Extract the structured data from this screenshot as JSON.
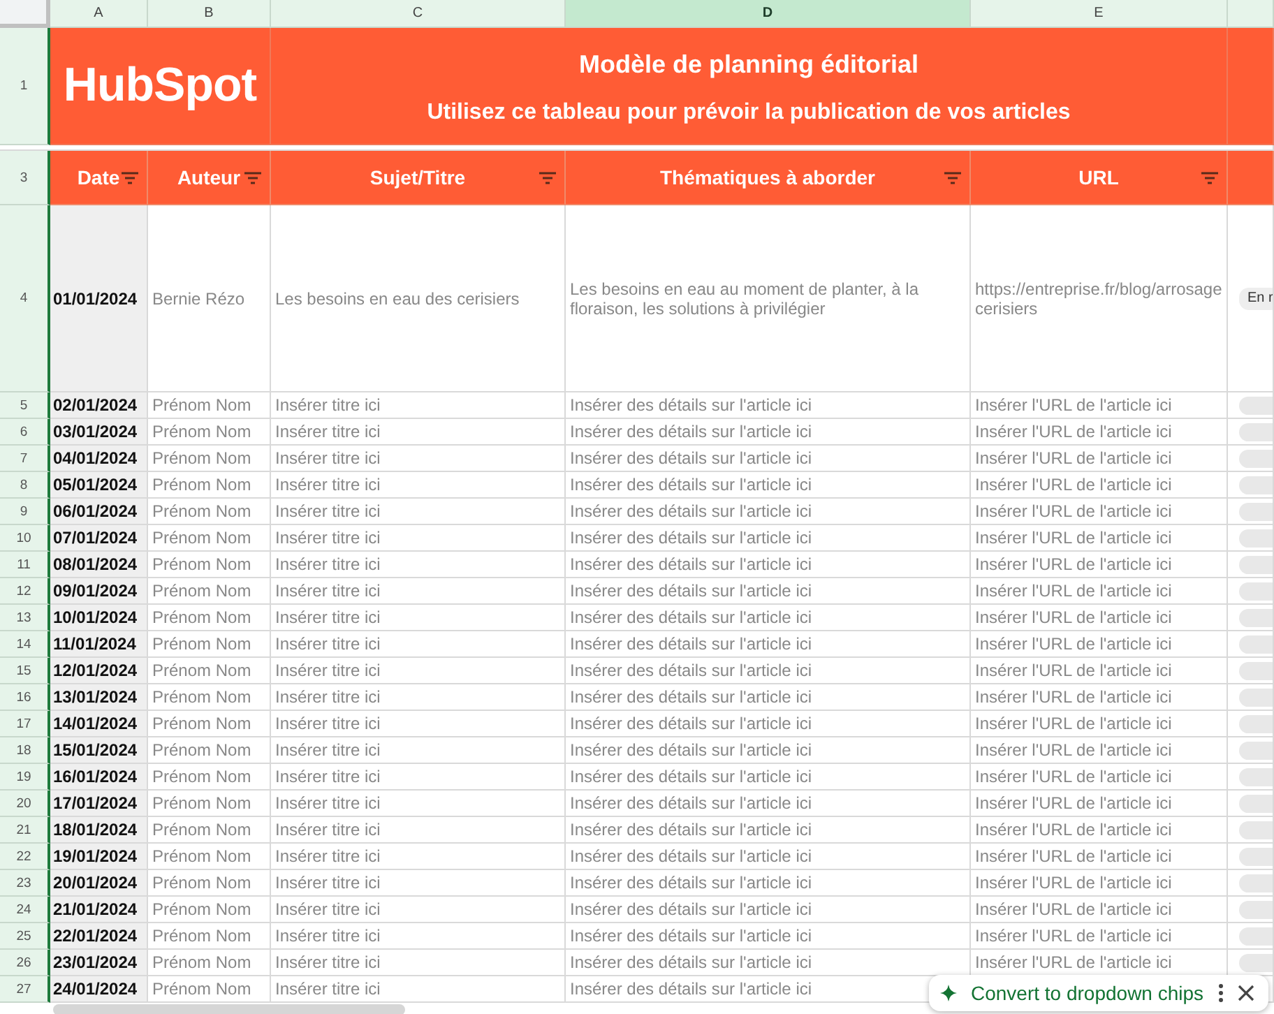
{
  "columns": [
    {
      "label": "A",
      "selected": false
    },
    {
      "label": "B",
      "selected": false
    },
    {
      "label": "C",
      "selected": false
    },
    {
      "label": "D",
      "selected": true
    },
    {
      "label": "E",
      "selected": false
    }
  ],
  "banner": {
    "row": "1",
    "logo": "HubSpot",
    "title": "Modèle de planning éditorial",
    "subtitle": "Utilisez ce tableau pour prévoir la publication de vos articles"
  },
  "header_row": {
    "row": "3",
    "headers": [
      {
        "label": "Date",
        "filter": true
      },
      {
        "label": "Auteur",
        "filter": true
      },
      {
        "label": "Sujet/Titre",
        "filter": true
      },
      {
        "label": "Thématiques à aborder",
        "filter": true
      },
      {
        "label": "URL",
        "filter": true
      }
    ]
  },
  "rows": [
    {
      "row": "4",
      "date": "01/01/2024",
      "author": "Bernie Rézo",
      "title": "Les besoins en eau des cerisiers",
      "topics": "Les besoins en eau au moment de planter, à la floraison, les solutions à privilégier",
      "url": "https://entreprise.fr/blog/arrosage cerisiers",
      "status": "En r"
    },
    {
      "row": "5",
      "date": "02/01/2024",
      "author": "Prénom Nom",
      "title": "Insérer titre ici",
      "topics": "Insérer des détails sur l'article ici",
      "url": "Insérer l'URL de l'article ici",
      "status_chip": true
    },
    {
      "row": "6",
      "date": "03/01/2024",
      "author": "Prénom Nom",
      "title": "Insérer titre ici",
      "topics": "Insérer des détails sur l'article ici",
      "url": "Insérer l'URL de l'article ici",
      "status_chip": true
    },
    {
      "row": "7",
      "date": "04/01/2024",
      "author": "Prénom Nom",
      "title": "Insérer titre ici",
      "topics": "Insérer des détails sur l'article ici",
      "url": "Insérer l'URL de l'article ici",
      "status_chip": true
    },
    {
      "row": "8",
      "date": "05/01/2024",
      "author": "Prénom Nom",
      "title": "Insérer titre ici",
      "topics": "Insérer des détails sur l'article ici",
      "url": "Insérer l'URL de l'article ici",
      "status_chip": true
    },
    {
      "row": "9",
      "date": "06/01/2024",
      "author": "Prénom Nom",
      "title": "Insérer titre ici",
      "topics": "Insérer des détails sur l'article ici",
      "url": "Insérer l'URL de l'article ici",
      "status_chip": true
    },
    {
      "row": "10",
      "date": "07/01/2024",
      "author": "Prénom Nom",
      "title": "Insérer titre ici",
      "topics": "Insérer des détails sur l'article ici",
      "url": "Insérer l'URL de l'article ici",
      "status_chip": true
    },
    {
      "row": "11",
      "date": "08/01/2024",
      "author": "Prénom Nom",
      "title": "Insérer titre ici",
      "topics": "Insérer des détails sur l'article ici",
      "url": "Insérer l'URL de l'article ici",
      "status_chip": true
    },
    {
      "row": "12",
      "date": "09/01/2024",
      "author": "Prénom Nom",
      "title": "Insérer titre ici",
      "topics": "Insérer des détails sur l'article ici",
      "url": "Insérer l'URL de l'article ici",
      "status_chip": true
    },
    {
      "row": "13",
      "date": "10/01/2024",
      "author": "Prénom Nom",
      "title": "Insérer titre ici",
      "topics": "Insérer des détails sur l'article ici",
      "url": "Insérer l'URL de l'article ici",
      "status_chip": true
    },
    {
      "row": "14",
      "date": "11/01/2024",
      "author": "Prénom Nom",
      "title": "Insérer titre ici",
      "topics": "Insérer des détails sur l'article ici",
      "url": "Insérer l'URL de l'article ici",
      "status_chip": true
    },
    {
      "row": "15",
      "date": "12/01/2024",
      "author": "Prénom Nom",
      "title": "Insérer titre ici",
      "topics": "Insérer des détails sur l'article ici",
      "url": "Insérer l'URL de l'article ici",
      "status_chip": true
    },
    {
      "row": "16",
      "date": "13/01/2024",
      "author": "Prénom Nom",
      "title": "Insérer titre ici",
      "topics": "Insérer des détails sur l'article ici",
      "url": "Insérer l'URL de l'article ici",
      "status_chip": true
    },
    {
      "row": "17",
      "date": "14/01/2024",
      "author": "Prénom Nom",
      "title": "Insérer titre ici",
      "topics": "Insérer des détails sur l'article ici",
      "url": "Insérer l'URL de l'article ici",
      "status_chip": true
    },
    {
      "row": "18",
      "date": "15/01/2024",
      "author": "Prénom Nom",
      "title": "Insérer titre ici",
      "topics": "Insérer des détails sur l'article ici",
      "url": "Insérer l'URL de l'article ici",
      "status_chip": true
    },
    {
      "row": "19",
      "date": "16/01/2024",
      "author": "Prénom Nom",
      "title": "Insérer titre ici",
      "topics": "Insérer des détails sur l'article ici",
      "url": "Insérer l'URL de l'article ici",
      "status_chip": true
    },
    {
      "row": "20",
      "date": "17/01/2024",
      "author": "Prénom Nom",
      "title": "Insérer titre ici",
      "topics": "Insérer des détails sur l'article ici",
      "url": "Insérer l'URL de l'article ici",
      "status_chip": true
    },
    {
      "row": "21",
      "date": "18/01/2024",
      "author": "Prénom Nom",
      "title": "Insérer titre ici",
      "topics": "Insérer des détails sur l'article ici",
      "url": "Insérer l'URL de l'article ici",
      "status_chip": true
    },
    {
      "row": "22",
      "date": "19/01/2024",
      "author": "Prénom Nom",
      "title": "Insérer titre ici",
      "topics": "Insérer des détails sur l'article ici",
      "url": "Insérer l'URL de l'article ici",
      "status_chip": true
    },
    {
      "row": "23",
      "date": "20/01/2024",
      "author": "Prénom Nom",
      "title": "Insérer titre ici",
      "topics": "Insérer des détails sur l'article ici",
      "url": "Insérer l'URL de l'article ici",
      "status_chip": true
    },
    {
      "row": "24",
      "date": "21/01/2024",
      "author": "Prénom Nom",
      "title": "Insérer titre ici",
      "topics": "Insérer des détails sur l'article ici",
      "url": "Insérer l'URL de l'article ici",
      "status_chip": true
    },
    {
      "row": "25",
      "date": "22/01/2024",
      "author": "Prénom Nom",
      "title": "Insérer titre ici",
      "topics": "Insérer des détails sur l'article ici",
      "url": "Insérer l'URL de l'article ici",
      "status_chip": true
    },
    {
      "row": "26",
      "date": "23/01/2024",
      "author": "Prénom Nom",
      "title": "Insérer titre ici",
      "topics": "Insérer des détails sur l'article ici",
      "url": "Insérer l'URL de l'article ici",
      "status_chip": true
    },
    {
      "row": "27",
      "date": "24/01/2024",
      "author": "Prénom Nom",
      "title": "Insérer titre ici",
      "topics": "Insérer des détails sur l'article ici",
      "status_chip": false
    }
  ],
  "toast": {
    "label": "Convert to dropdown chips"
  }
}
